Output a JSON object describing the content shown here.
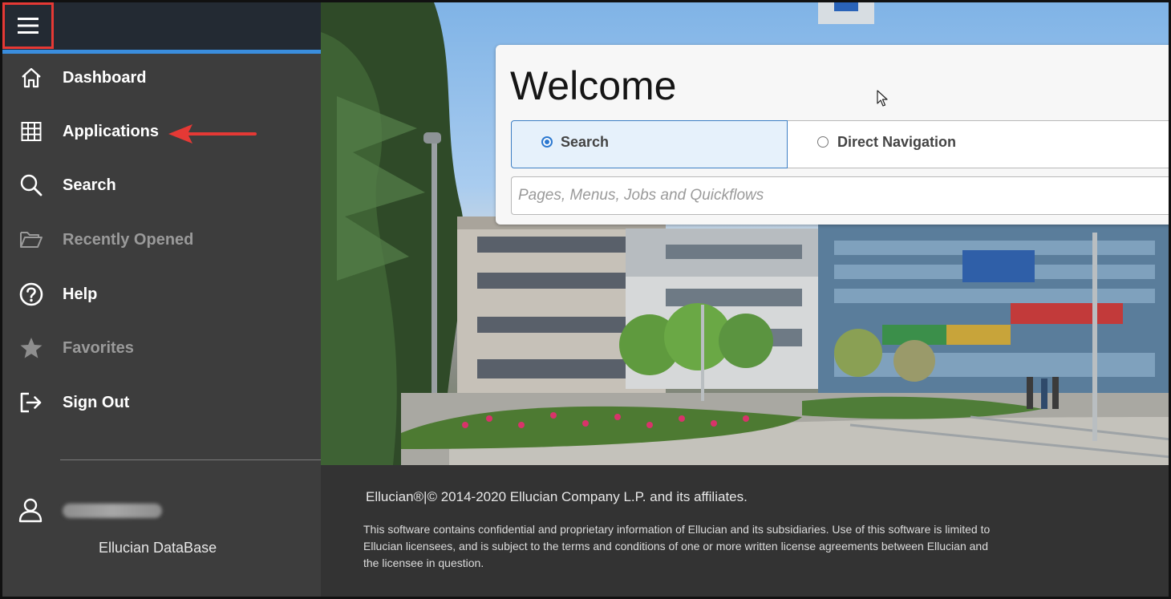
{
  "sidebar": {
    "menu_icon": "hamburger-menu-icon",
    "items": [
      {
        "label": "Dashboard",
        "icon": "home-icon",
        "enabled": true
      },
      {
        "label": "Applications",
        "icon": "grid-icon",
        "enabled": true
      },
      {
        "label": "Search",
        "icon": "search-icon",
        "enabled": true
      },
      {
        "label": "Recently Opened",
        "icon": "folder-open-icon",
        "enabled": false
      },
      {
        "label": "Help",
        "icon": "help-circle-icon",
        "enabled": true
      },
      {
        "label": "Favorites",
        "icon": "star-icon",
        "enabled": false
      },
      {
        "label": "Sign Out",
        "icon": "sign-out-icon",
        "enabled": true
      }
    ],
    "user": {
      "icon": "user-icon"
    },
    "database": "Ellucian DataBase"
  },
  "welcome": {
    "title": "Welcome",
    "modes": [
      {
        "label": "Search",
        "selected": true
      },
      {
        "label": "Direct Navigation",
        "selected": false
      }
    ],
    "search_placeholder": "Pages, Menus, Jobs and Quickflows"
  },
  "footer": {
    "copyright": "Ellucian®|© 2014-2020 Ellucian Company L.P. and its affiliates.",
    "legal": "This software contains confidential and proprietary information of Ellucian and its subsidiaries. Use of this software is limited to Ellucian licensees, and is subject to the terms and conditions of one or more written license agreements between Ellucian and the licensee in question."
  },
  "colors": {
    "accent": "#3a8ddd",
    "annotation": "#e53935",
    "sidebar": "#3d3d3d",
    "sidebar_header": "#232a33"
  }
}
